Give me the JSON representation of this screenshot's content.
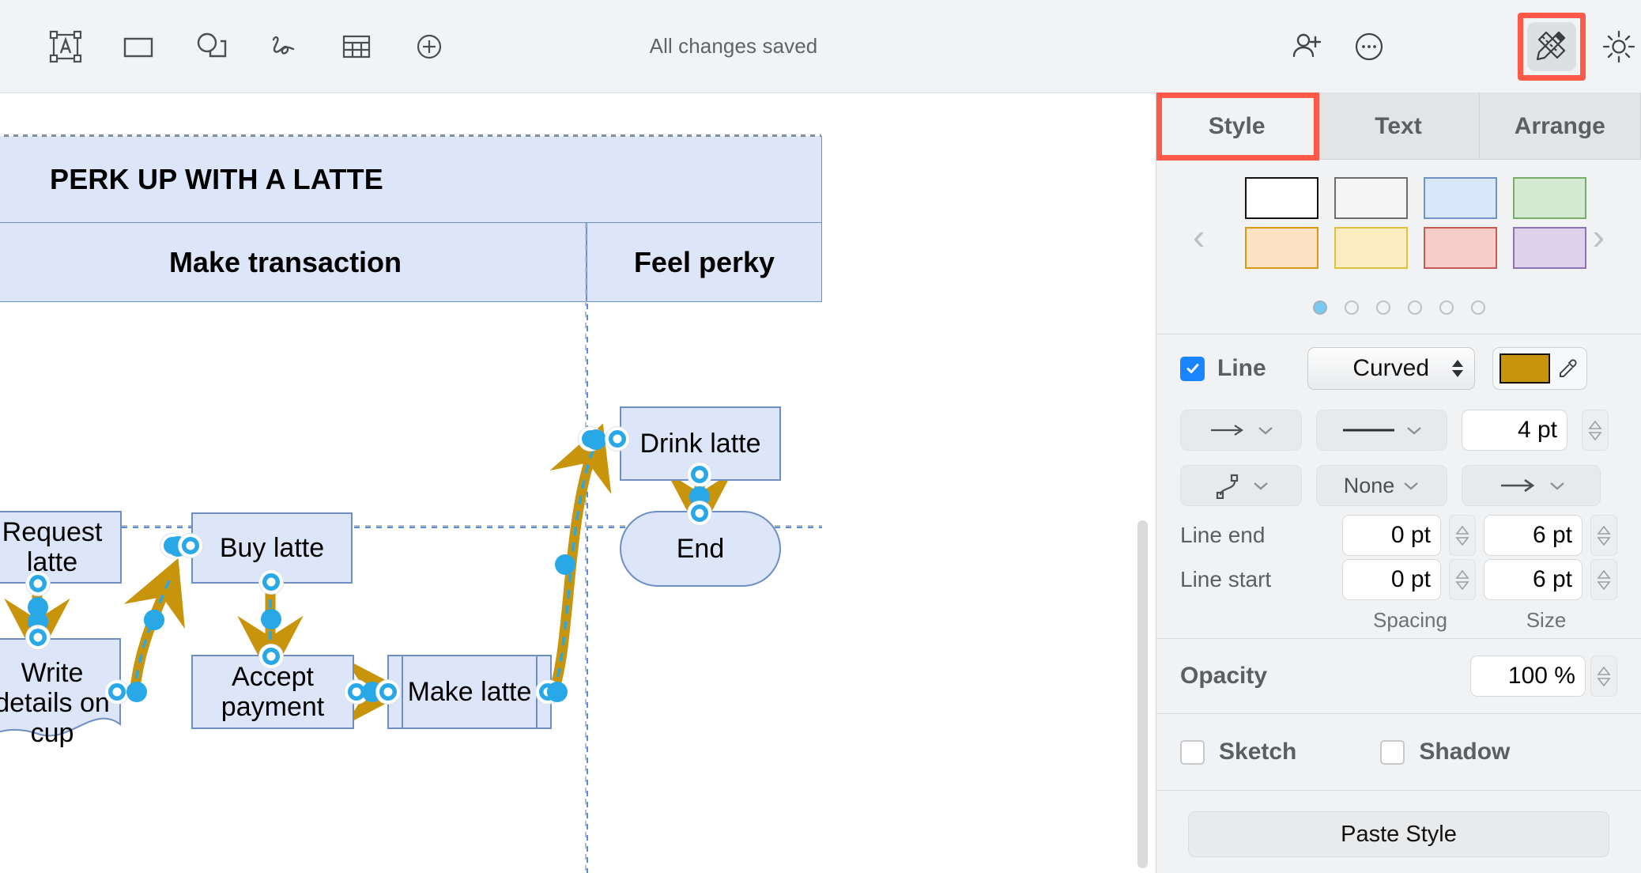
{
  "toolbar": {
    "tools": [
      {
        "name": "text-box-tool",
        "icon": "text-box-icon"
      },
      {
        "name": "rectangle-tool",
        "icon": "rectangle-icon"
      },
      {
        "name": "shapes-tool",
        "icon": "shapes-icon"
      },
      {
        "name": "draw-tool",
        "icon": "pen-scribble-icon"
      },
      {
        "name": "table-tool",
        "icon": "table-icon"
      },
      {
        "name": "insert-tool",
        "icon": "plus-circle-icon"
      }
    ],
    "status": "All changes saved",
    "share_icon": "add-person-icon",
    "more_icon": "more-ellipsis-icon",
    "format_icon": "pencil-ruler-icon",
    "appearance_icon": "brightness-sun-icon"
  },
  "panel": {
    "tabs": [
      {
        "label": "Style",
        "active": true
      },
      {
        "label": "Text",
        "active": false
      },
      {
        "label": "Arrange",
        "active": false
      }
    ],
    "swatches": [
      {
        "fill": "#ffffff",
        "border": "#111111"
      },
      {
        "fill": "#f5f5f5",
        "border": "#6d6d6d"
      },
      {
        "fill": "#d9e7fb",
        "border": "#6e93c9"
      },
      {
        "fill": "#d4e9d2",
        "border": "#79ab6a"
      },
      {
        "fill": "#fde2c4",
        "border": "#d79b12"
      },
      {
        "fill": "#fdeec2",
        "border": "#e0c13f"
      },
      {
        "fill": "#f6cdc9",
        "border": "#c55b53"
      },
      {
        "fill": "#ddd2ea",
        "border": "#8e72b6"
      }
    ],
    "page_dots": 6,
    "active_page_dot": 1,
    "prev_arrow": "‹",
    "next_arrow": "›",
    "line": {
      "checkbox_label": "Line",
      "checked": true,
      "shape_value": "Curved",
      "color": "#c8940c",
      "eyedropper_icon": "eyedropper-icon",
      "arrow_style_icon": "arrow-right-icon",
      "stroke_style_icon": "solid-line-icon",
      "width_value": "4 pt",
      "connector_icon": "curved-connector-icon",
      "start_marker_value": "None",
      "end_marker_icon": "arrow-end-icon"
    },
    "line_end": {
      "label": "Line end",
      "spacing": "0 pt",
      "size": "6 pt"
    },
    "line_start": {
      "label": "Line start",
      "spacing": "0 pt",
      "size": "6 pt"
    },
    "column_captions": {
      "spacing": "Spacing",
      "size": "Size"
    },
    "opacity": {
      "label": "Opacity",
      "value": "100 %"
    },
    "sketch": {
      "label": "Sketch",
      "checked": false
    },
    "shadow": {
      "label": "Shadow",
      "checked": false
    },
    "paste_style_label": "Paste Style",
    "highlight_color": "#ff5a48"
  },
  "canvas": {
    "title_band": "PERK UP WITH A LATTE",
    "lanes": [
      {
        "label": "Make transaction"
      },
      {
        "label": "Feel perky"
      }
    ],
    "nodes": [
      {
        "id": "request-latte",
        "label": "Request latte",
        "shape": "rect"
      },
      {
        "id": "buy-latte",
        "label": "Buy latte",
        "shape": "rect"
      },
      {
        "id": "write-details-on-cup",
        "label": "Write details on cup",
        "shape": "document"
      },
      {
        "id": "accept-payment",
        "label": "Accept payment",
        "shape": "rect"
      },
      {
        "id": "make-latte",
        "label": "Make latte",
        "shape": "predefined-process"
      },
      {
        "id": "drink-latte",
        "label": "Drink latte",
        "shape": "rect"
      },
      {
        "id": "end",
        "label": "End",
        "shape": "pill"
      }
    ],
    "connector_color": "#c8940c",
    "selection_color": "#29a8e8",
    "node_fill": "#dce6f8",
    "node_border": "#6f8fc4"
  }
}
